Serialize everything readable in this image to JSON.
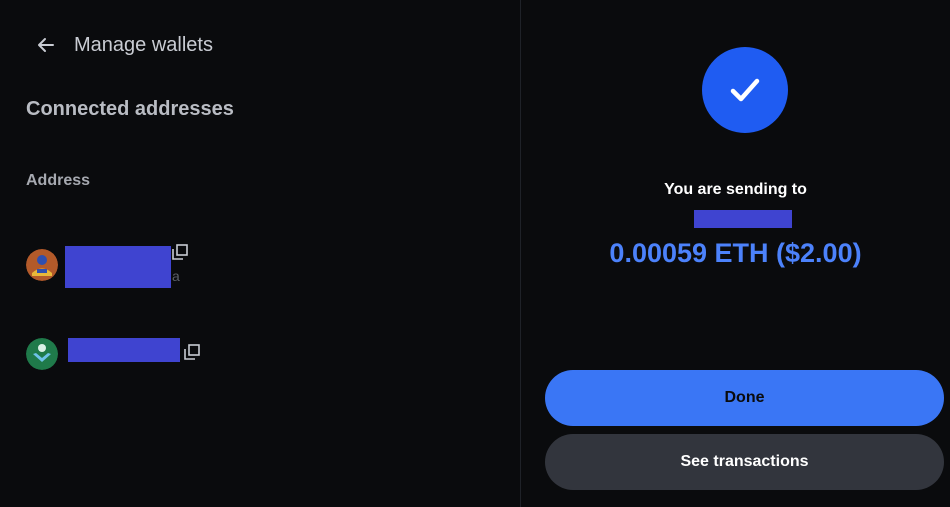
{
  "left": {
    "header_title": "Manage wallets",
    "section_title": "Connected addresses",
    "column_label": "Address",
    "wallets": [
      {
        "avatar": "avatar-orange",
        "address_tail": "a"
      },
      {
        "avatar": "avatar-green",
        "address_tail": ""
      }
    ]
  },
  "right": {
    "sending_label": "You are sending to",
    "amount": "0.00059 ETH ($2.00)"
  },
  "buttons": {
    "done": "Done",
    "see_transactions": "See transactions"
  },
  "colors": {
    "background": "#0a0b0d",
    "accent": "#1f5cf2",
    "amount": "#4c82fb",
    "done_button": "#3a76f5",
    "secondary_button": "#32353d",
    "redaction": "#3f44d0"
  },
  "icons": [
    "back-arrow-icon",
    "copy-icon",
    "checkmark-icon"
  ]
}
